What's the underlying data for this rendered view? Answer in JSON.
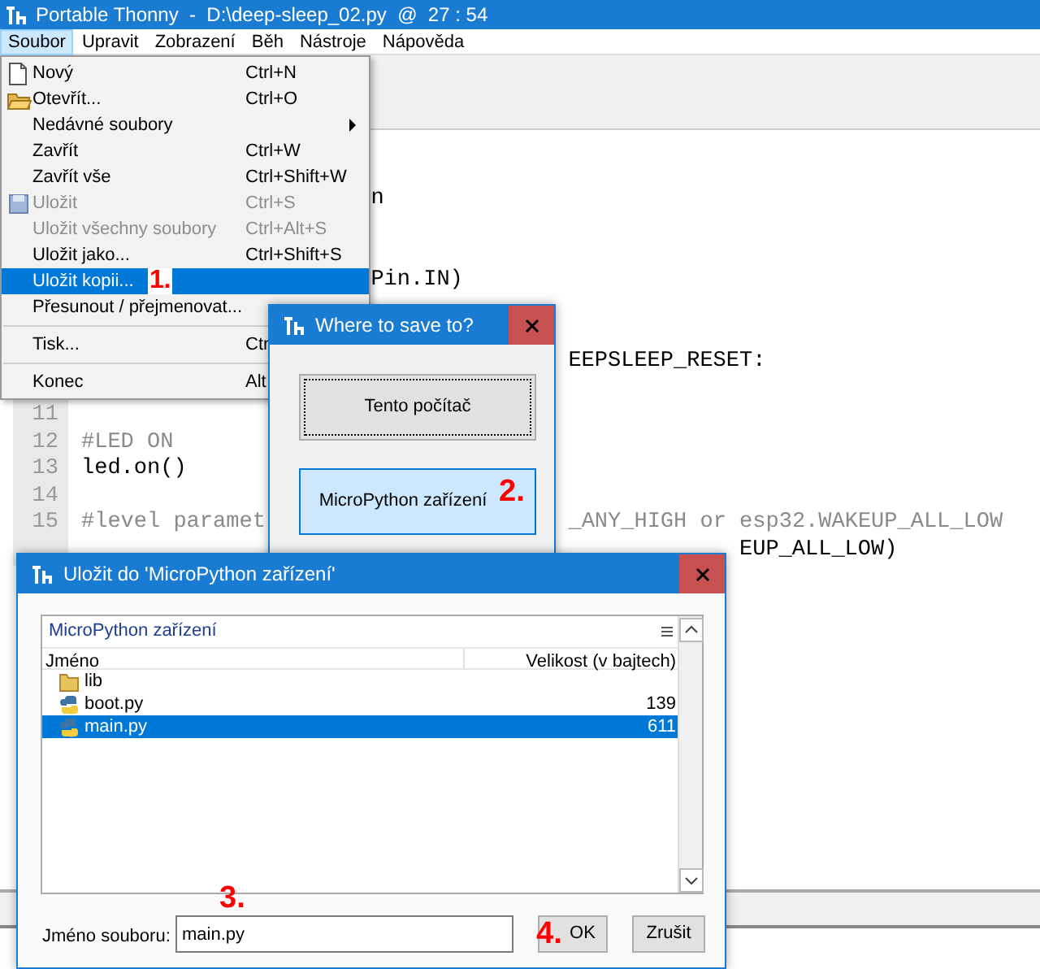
{
  "window": {
    "title": "Portable Thonny  -  D:\\deep-sleep_02.py  @  27 : 54"
  },
  "menubar": [
    {
      "label": "Soubor",
      "selected": true
    },
    {
      "label": "Upravit",
      "selected": false
    },
    {
      "label": "Zobrazení",
      "selected": false
    },
    {
      "label": "Běh",
      "selected": false
    },
    {
      "label": "Nástroje",
      "selected": false
    },
    {
      "label": "Nápověda",
      "selected": false
    }
  ],
  "file_menu": [
    {
      "label": "Nový",
      "shortcut": "Ctrl+N",
      "disabled": false,
      "selected": false
    },
    {
      "label": "Otevřít...",
      "shortcut": "Ctrl+O",
      "disabled": false,
      "selected": false
    },
    {
      "label": "Nedávné soubory",
      "submenu": true,
      "disabled": false,
      "selected": false
    },
    {
      "label": "Zavřít",
      "shortcut": "Ctrl+W",
      "disabled": false,
      "selected": false
    },
    {
      "label": "Zavřít vše",
      "shortcut": "Ctrl+Shift+W",
      "disabled": false,
      "selected": false
    },
    {
      "label": "Uložit",
      "shortcut": "Ctrl+S",
      "disabled": true,
      "selected": false
    },
    {
      "label": "Uložit všechny soubory",
      "shortcut": "Ctrl+Alt+S",
      "disabled": true,
      "selected": false
    },
    {
      "label": "Uložit jako...",
      "shortcut": "Ctrl+Shift+S",
      "disabled": false,
      "selected": false
    },
    {
      "label": "Uložit kopii...",
      "disabled": false,
      "selected": true,
      "annotation": "1."
    },
    {
      "label": "Přesunout / přejmenovat...",
      "disabled": false,
      "selected": false,
      "separator_after": true
    },
    {
      "label": "Tisk...",
      "shortcut": "Ctr",
      "disabled": false,
      "selected": false,
      "separator_after": true
    },
    {
      "label": "Konec",
      "shortcut": "Alt",
      "disabled": false,
      "selected": false
    }
  ],
  "editor": {
    "lines": [
      {
        "segments": [
          {
            "text": "n",
            "kind": "code"
          }
        ]
      },
      {
        "segments": [
          {
            "text": "Pin.IN)",
            "kind": "code"
          }
        ]
      },
      {
        "segments": [
          {
            "text": "EEPSLEEP_RESET:",
            "kind": "code"
          }
        ]
      },
      {
        "number": "11"
      },
      {
        "number": "12",
        "segments": [
          {
            "text": "#LED ON",
            "kind": "comment"
          }
        ]
      },
      {
        "number": "13",
        "segments": [
          {
            "text": "led.on()",
            "kind": "code"
          }
        ]
      },
      {
        "number": "14"
      },
      {
        "number": "15",
        "segments": [
          {
            "text": "#level paramet",
            "kind": "comment"
          },
          {
            "text": "_ANY_HIGH or esp32.WAKEUP_ALL_LOW",
            "kind": "comment"
          }
        ]
      },
      {
        "segments": [
          {
            "text": "EUP_ALL_LOW)",
            "kind": "code"
          }
        ]
      }
    ]
  },
  "where_dialog": {
    "title": "Where to save to?",
    "buttons": [
      {
        "label": "Tento počítač",
        "selected": false
      },
      {
        "label": "MicroPython zařízení",
        "selected": true,
        "annotation": "2."
      }
    ]
  },
  "save_dialog": {
    "title": "Uložit do 'MicroPython zařízení'",
    "location": "MicroPython zařízení",
    "columns": [
      "Jméno",
      "Velikost (v bajtech)"
    ],
    "rows": [
      {
        "name": "lib",
        "kind": "folder",
        "selected": false
      },
      {
        "name": "boot.py",
        "size": "139",
        "kind": "file",
        "selected": false
      },
      {
        "name": "main.py",
        "size": "611",
        "kind": "file",
        "selected": true
      }
    ],
    "filename_label": "Jméno souboru:",
    "filename": "main.py",
    "filename_annotation": "3.",
    "ok": "OK",
    "ok_annotation": "4.",
    "cancel": "Zrušit"
  }
}
